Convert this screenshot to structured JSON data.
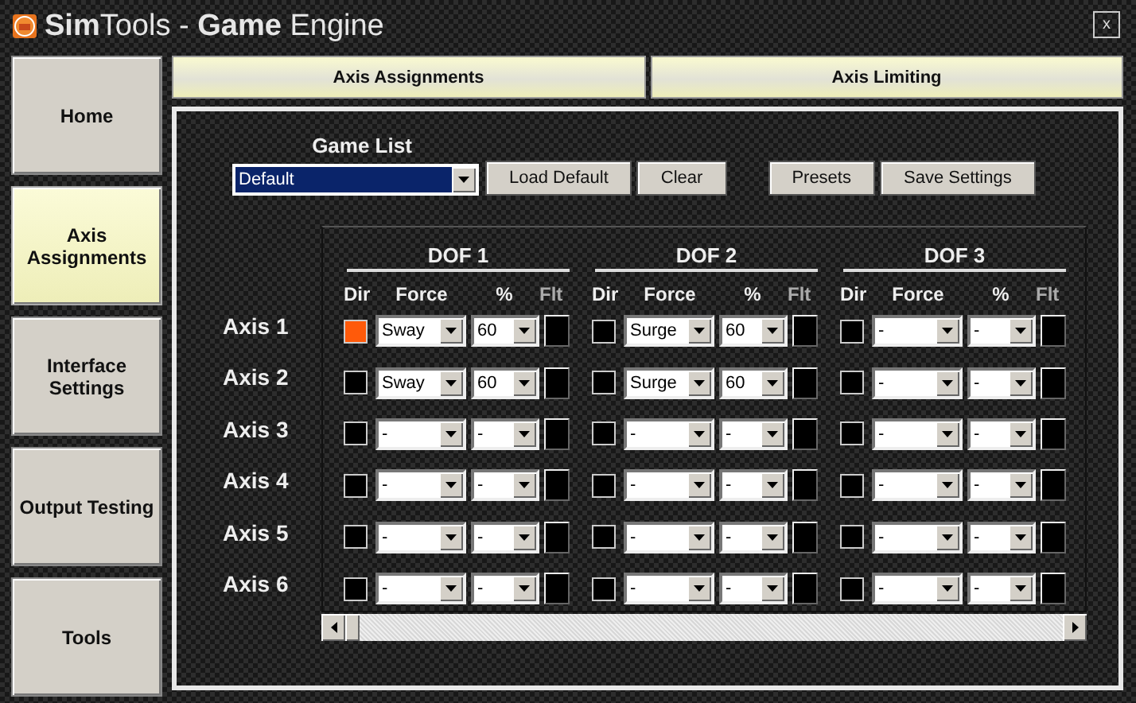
{
  "window": {
    "title": "**Sim**Tools - **Game** Engine",
    "close": "x"
  },
  "sidebar": {
    "items": [
      {
        "label": "Home",
        "selected": false
      },
      {
        "label": "Axis Assignments",
        "selected": true
      },
      {
        "label": "Interface Settings",
        "selected": false
      },
      {
        "label": "Output Testing",
        "selected": false
      },
      {
        "label": "Tools",
        "selected": false
      }
    ]
  },
  "tabs": [
    {
      "label": "Axis Assignments",
      "selected": false
    },
    {
      "label": "Axis Limiting",
      "selected": false
    }
  ],
  "game_list": {
    "label": "Game List",
    "value": "Default"
  },
  "button_groups": [
    [
      "Load Default",
      "Clear"
    ],
    [
      "Presets",
      "Save Settings"
    ]
  ],
  "dofs": [
    {
      "title": "DOF 1",
      "headers": [
        "Dir",
        "Force",
        "%",
        "Flt"
      ]
    },
    {
      "title": "DOF 2",
      "headers": [
        "Dir",
        "Force",
        "%",
        "Flt"
      ]
    },
    {
      "title": "DOF 3",
      "headers": [
        "Dir",
        "Force",
        "%",
        "Flt"
      ]
    }
  ],
  "axes": [
    {
      "label": "Axis 1",
      "dofs": [
        {
          "dir": true,
          "force": "Sway",
          "percent": "60"
        },
        {
          "dir": false,
          "force": "Surge",
          "percent": "60"
        },
        {
          "dir": false,
          "force": "-",
          "percent": "-"
        }
      ]
    },
    {
      "label": "Axis 2",
      "dofs": [
        {
          "dir": false,
          "force": "Sway",
          "percent": "60"
        },
        {
          "dir": false,
          "force": "Surge",
          "percent": "60"
        },
        {
          "dir": false,
          "force": "-",
          "percent": "-"
        }
      ]
    },
    {
      "label": "Axis 3",
      "dofs": [
        {
          "dir": false,
          "force": "-",
          "percent": "-"
        },
        {
          "dir": false,
          "force": "-",
          "percent": "-"
        },
        {
          "dir": false,
          "force": "-",
          "percent": "-"
        }
      ]
    },
    {
      "label": "Axis 4",
      "dofs": [
        {
          "dir": false,
          "force": "-",
          "percent": "-"
        },
        {
          "dir": false,
          "force": "-",
          "percent": "-"
        },
        {
          "dir": false,
          "force": "-",
          "percent": "-"
        }
      ]
    },
    {
      "label": "Axis 5",
      "dofs": [
        {
          "dir": false,
          "force": "-",
          "percent": "-"
        },
        {
          "dir": false,
          "force": "-",
          "percent": "-"
        },
        {
          "dir": false,
          "force": "-",
          "percent": "-"
        }
      ]
    },
    {
      "label": "Axis 6",
      "dofs": [
        {
          "dir": false,
          "force": "-",
          "percent": "-"
        },
        {
          "dir": false,
          "force": "-",
          "percent": "-"
        },
        {
          "dir": false,
          "force": "-",
          "percent": "-"
        }
      ]
    }
  ]
}
